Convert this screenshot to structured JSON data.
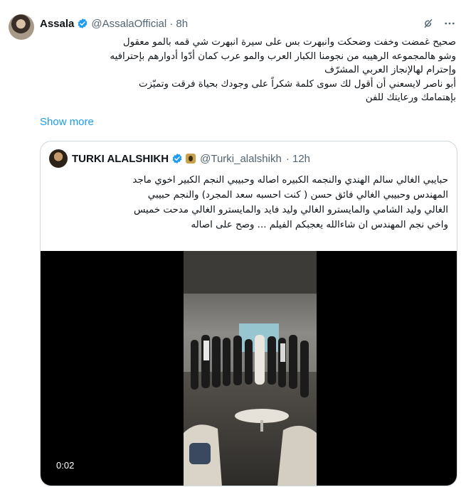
{
  "tweet": {
    "author_name": "Assala",
    "author_handle": "@AssalaOfficial",
    "time": "· 8h",
    "lines": [
      "صحيح غمضت وخفت وضحكت وانبهرت بس على سيرة انبهرت شي قمه بالمو معقول",
      "وشو هالمجموعه الرهيبه من نجومنا الكبار العرب والمو عرب كمان أدّوا أدوارهم بإحترافيه",
      "وإحترام لهالإنجاز العربي المشرّف",
      "أبو ناصر لايسعني أن أقول لك سوى كلمة شكراً على وجودك بحياة فرقت وتميّزت",
      "بإهتمامك ورعايتك للفن"
    ],
    "show_more": "Show more"
  },
  "quoted": {
    "author_name": "TURKI ALALSHIKH",
    "author_handle": "@Turki_alalshikh",
    "time": "· 12h",
    "lines": [
      "حبايبي الغالي سالم الهندي والنجمه الكبيره اصاله وحبيبي النجم الكبير اخوي ماجد",
      "المهندس وحبيبي الغالي فائق حسن ( كنت احسبه سعد المجرد) والنجم حبيبي",
      "الغالي وليد الشامي والمايسترو الغالي وليد فايد والمايسترو الغالي مدحت خميس",
      "واخي نجم المهندس ان شاءالله يعجبكم الفيلم ... وصح على اصاله"
    ],
    "video_duration": "0:02"
  },
  "colors": {
    "link": "#1d9bf0",
    "muted": "#536471",
    "verified": "#1d9bf0",
    "border": "#cfd9de"
  },
  "icons": [
    "verified-icon",
    "grok-icon",
    "more-icon",
    "org-badge-icon"
  ]
}
